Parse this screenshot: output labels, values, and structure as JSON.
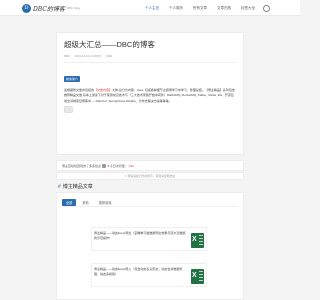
{
  "header": {
    "logo_mark": "D",
    "logo_text": "DBC的博客",
    "logo_sub": "DBC blog",
    "nav": [
      "个人主页",
      "个人简历",
      "所有文章",
      "文章归档",
      "标签大全"
    ]
  },
  "article": {
    "title": "超级大汇总——DBC的博客",
    "meta": [
      "DBC",
      "2021-10-12 10:28:45",
      "1364"
    ],
    "badge": "前言简介",
    "para_pre": "最根据所文章内包括的",
    "para_hl": "【文章内容】",
    "para_post": "大体,总分为内容：Java, 包括各种细节主题博学习中学习、整理总结。【博主精品】系列包含推荐精品文章,基本上通读下对于使用常见技术与（三大技术家族开始中间件）RabbitMQ, RocketMQ, Kafka、Redis, ES、开源应用全领域项目博客中 — Rancher, SpringCloud Alibaba、分布式解决方案等等等。"
  },
  "tip": {
    "text_a": "博主苦哈哈回到的了多多给点",
    "star": "★",
    "text_b": "今日访问量：",
    "count": "156"
  },
  "copyright": "© 博客版权归作者所有，转载请注明出处",
  "recommend": {
    "title": "博主精品文章",
    "tabs": [
      "全部",
      "其他",
      "推荐阅读"
    ],
    "items": [
      {
        "text": "博主精品——动态Excel导出（掌握单元格数据导出效果与原文及数据的示范操作）"
      },
      {
        "text": "博主精品——动态Excel导入（包含动态表头形态，动态合并数据处理，动态多模版）"
      }
    ]
  }
}
